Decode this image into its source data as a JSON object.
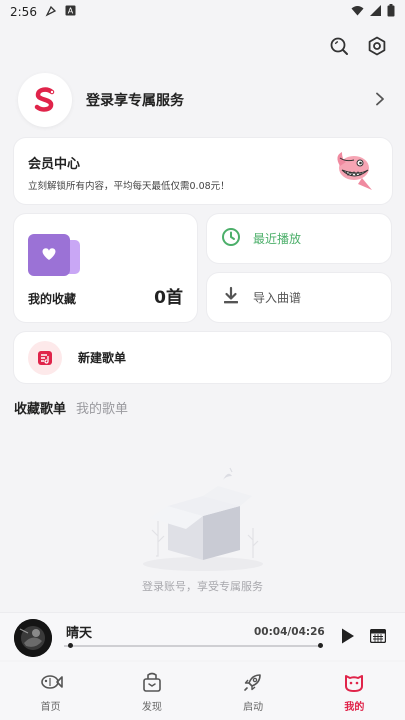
{
  "statusbar": {
    "time": "2:56",
    "icons": [
      "notification-icon",
      "a-icon",
      "wifi-icon",
      "signal-icon",
      "battery-icon"
    ]
  },
  "header": {
    "icons": [
      "search-icon",
      "settings-icon"
    ]
  },
  "login": {
    "text": "登录享专属服务"
  },
  "vip": {
    "title": "会员中心",
    "subtitle": "立刻解锁所有内容，平均每天最低仅需0.08元！"
  },
  "favorites": {
    "label": "我的收藏",
    "count": "0首"
  },
  "recent": {
    "label": "最近播放"
  },
  "import": {
    "label": "导入曲谱"
  },
  "new_playlist": {
    "label": "新建歌单"
  },
  "tabs": [
    {
      "label": "收藏歌单",
      "active": true
    },
    {
      "label": "我的歌单",
      "active": false
    }
  ],
  "empty_state": {
    "text": "登录账号，享受专属服务"
  },
  "player": {
    "title": "晴天",
    "time": "00:04/04:26",
    "progress": 0.015
  },
  "nav": [
    {
      "label": "首页",
      "icon": "fish-icon"
    },
    {
      "label": "发现",
      "icon": "box-icon"
    },
    {
      "label": "启动",
      "icon": "rocket-icon"
    },
    {
      "label": "我的",
      "icon": "mascot-icon",
      "active": true
    }
  ],
  "colors": {
    "accent": "#e0244a",
    "recent_green": "#4caf6a",
    "purple": "#9b72d6",
    "background": "#f4f4f6"
  }
}
